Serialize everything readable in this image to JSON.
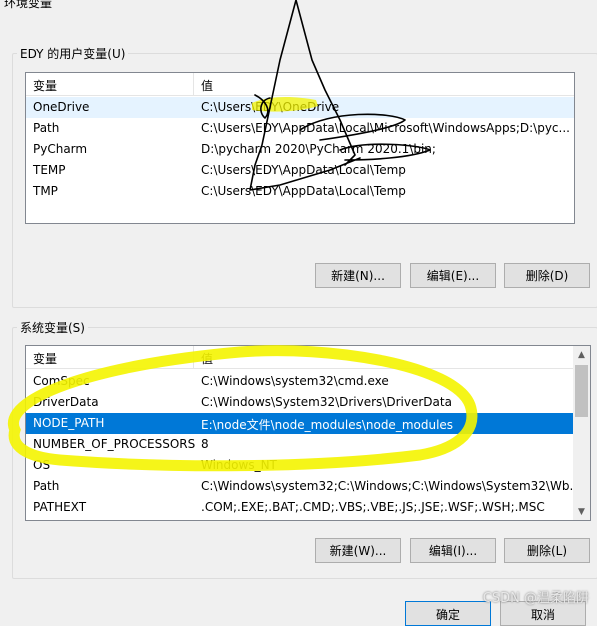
{
  "window": {
    "title": "环境变量"
  },
  "user_vars": {
    "group_label": "EDY 的用户变量(U)",
    "col_variable": "变量",
    "col_value": "值",
    "rows": [
      {
        "name": "OneDrive",
        "value": "C:\\Users\\EDY\\OneDrive"
      },
      {
        "name": "Path",
        "value": "C:\\Users\\EDY\\AppData\\Local\\Microsoft\\WindowsApps;D:\\pyc..."
      },
      {
        "name": "PyCharm",
        "value": "D:\\pycharm 2020\\PyCharm 2020.1\\bin;"
      },
      {
        "name": "TEMP",
        "value": "C:\\Users\\EDY\\AppData\\Local\\Temp"
      },
      {
        "name": "TMP",
        "value": "C:\\Users\\EDY\\AppData\\Local\\Temp"
      }
    ],
    "buttons": {
      "new": "新建(N)...",
      "edit": "编辑(E)...",
      "delete": "删除(D)"
    }
  },
  "system_vars": {
    "group_label": "系统变量(S)",
    "col_variable": "变量",
    "col_value": "值",
    "rows": [
      {
        "name": "ComSpec",
        "value": "C:\\Windows\\system32\\cmd.exe"
      },
      {
        "name": "DriverData",
        "value": "C:\\Windows\\System32\\Drivers\\DriverData"
      },
      {
        "name": "NODE_PATH",
        "value": "E:\\node文件\\node_modules\\node_modules"
      },
      {
        "name": "NUMBER_OF_PROCESSORS",
        "value": "8"
      },
      {
        "name": "OS",
        "value": "Windows_NT"
      },
      {
        "name": "Path",
        "value": "C:\\Windows\\system32;C:\\Windows;C:\\Windows\\System32\\Wb..."
      },
      {
        "name": "PATHEXT",
        "value": ".COM;.EXE;.BAT;.CMD;.VBS;.VBE;.JS;.JSE;.WSF;.WSH;.MSC"
      }
    ],
    "buttons": {
      "new": "新建(W)...",
      "edit": "编辑(I)...",
      "delete": "删除(L)"
    }
  },
  "dialog_buttons": {
    "ok": "确定",
    "cancel": "取消"
  },
  "watermark": "CSDN @温柔陷阱",
  "colors": {
    "selection": "#0078d7",
    "highlighter": "#f4f400",
    "ink": "#000000"
  }
}
